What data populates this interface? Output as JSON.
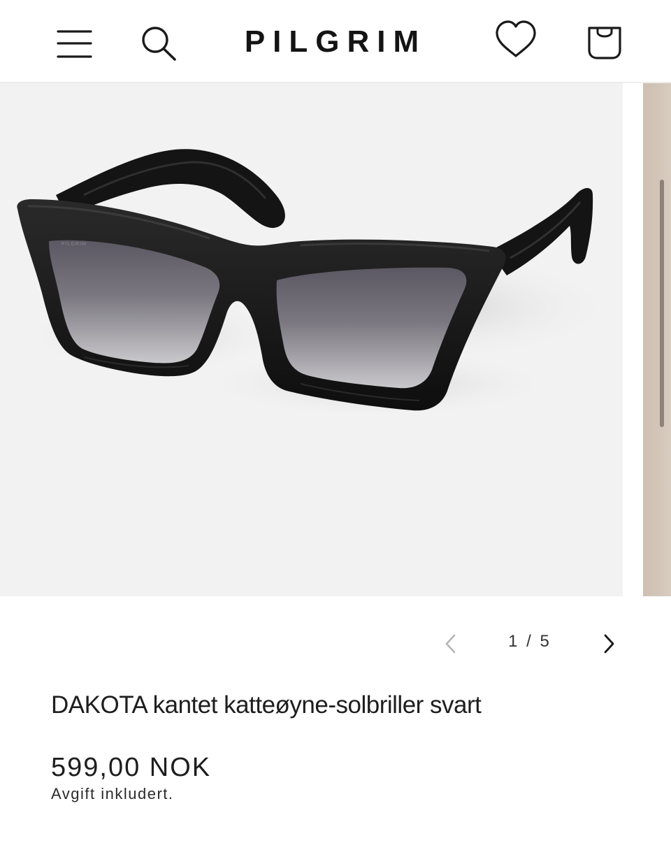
{
  "header": {
    "logo": "PILGRIM",
    "icons": {
      "menu": "menu-icon",
      "search": "search-icon",
      "wishlist": "heart-icon",
      "bag": "shopping-bag-icon"
    }
  },
  "gallery": {
    "current": 1,
    "total": 5,
    "counter_text": "1 / 5",
    "image": "black-cat-eye-sunglasses",
    "brand_imprint": "PILGRIM",
    "next_slide_color": "#d3c6b9"
  },
  "product": {
    "title": "DAKOTA kantet katteøyne-solbriller svart",
    "price": "599,00 NOK",
    "tax_note": "Avgift inkludert."
  },
  "colors": {
    "background": "#ffffff",
    "image_background": "#f2f2f2",
    "text": "#1e1e1e",
    "frame": "#121212"
  }
}
